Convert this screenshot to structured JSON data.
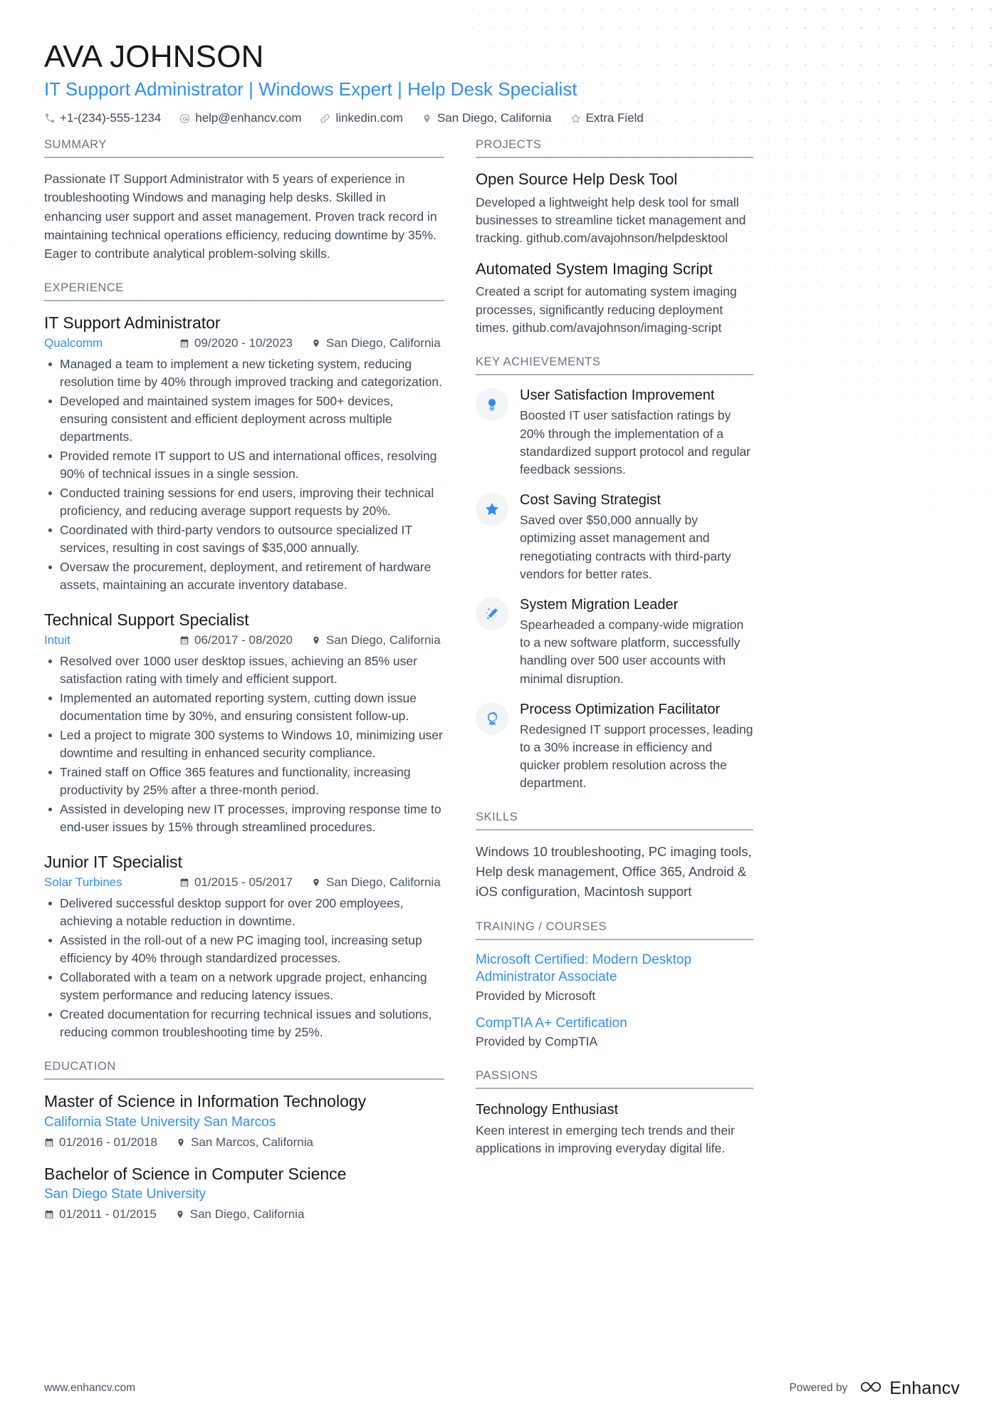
{
  "header": {
    "name": "AVA JOHNSON",
    "headline": "IT Support Administrator | Windows Expert | Help Desk Specialist",
    "contacts": [
      {
        "icon": "phone-icon",
        "text": "+1-(234)-555-1234"
      },
      {
        "icon": "email-icon",
        "text": "help@enhancv.com"
      },
      {
        "icon": "link-icon",
        "text": "linkedin.com"
      },
      {
        "icon": "location-pin-icon",
        "text": "San Diego, California"
      },
      {
        "icon": "star-outline-icon",
        "text": "Extra Field"
      }
    ]
  },
  "summary": {
    "heading": "SUMMARY",
    "text": "Passionate IT Support Administrator with 5 years of experience in troubleshooting Windows and managing help desks. Skilled in enhancing user support and asset management. Proven track record in maintaining technical operations efficiency, reducing downtime by 35%. Eager to contribute analytical problem-solving skills."
  },
  "experience": {
    "heading": "EXPERIENCE",
    "entries": [
      {
        "title": "IT Support Administrator",
        "company": "Qualcomm",
        "dates": "09/2020 - 10/2023",
        "location": "San Diego, California",
        "bullets": [
          "Managed a team to implement a new ticketing system, reducing resolution time by 40% through improved tracking and categorization.",
          "Developed and maintained system images for 500+ devices, ensuring consistent and efficient deployment across multiple departments.",
          "Provided remote IT support to US and international offices, resolving 90% of technical issues in a single session.",
          "Conducted training sessions for end users, improving their technical proficiency, and reducing average support requests by 20%.",
          "Coordinated with third-party vendors to outsource specialized IT services, resulting in cost savings of $35,000 annually.",
          "Oversaw the procurement, deployment, and retirement of hardware assets, maintaining an accurate inventory database."
        ]
      },
      {
        "title": "Technical Support Specialist",
        "company": "Intuit",
        "dates": "06/2017 - 08/2020",
        "location": "San Diego, California",
        "bullets": [
          "Resolved over 1000 user desktop issues, achieving an 85% user satisfaction rating with timely and efficient support.",
          "Implemented an automated reporting system, cutting down issue documentation time by 30%, and ensuring consistent follow-up.",
          "Led a project to migrate 300 systems to Windows 10, minimizing user downtime and resulting in enhanced security compliance.",
          "Trained staff on Office 365 features and functionality, increasing productivity by 25% after a three-month period.",
          "Assisted in developing new IT processes, improving response time to end-user issues by 15% through streamlined procedures."
        ]
      },
      {
        "title": "Junior IT Specialist",
        "company": "Solar Turbines",
        "dates": "01/2015 - 05/2017",
        "location": "San Diego, California",
        "bullets": [
          "Delivered successful desktop support for over 200 employees, achieving a notable reduction in downtime.",
          "Assisted in the roll-out of a new PC imaging tool, increasing setup efficiency by 40% through standardized processes.",
          "Collaborated with a team on a network upgrade project, enhancing system performance and reducing latency issues.",
          "Created documentation for recurring technical issues and solutions, reducing common troubleshooting time by 25%."
        ]
      }
    ]
  },
  "education": {
    "heading": "EDUCATION",
    "entries": [
      {
        "degree": "Master of Science in Information Technology",
        "school": "California State University San Marcos",
        "dates": "01/2016 - 01/2018",
        "location": "San Marcos, California"
      },
      {
        "degree": "Bachelor of Science in Computer Science",
        "school": "San Diego State University",
        "dates": "01/2011 - 01/2015",
        "location": "San Diego, California"
      }
    ]
  },
  "projects": {
    "heading": "PROJECTS",
    "entries": [
      {
        "title": "Open Source Help Desk Tool",
        "description": "Developed a lightweight help desk tool for small businesses to streamline ticket management and tracking. github.com/avajohnson/helpdesktool"
      },
      {
        "title": "Automated System Imaging Script",
        "description": "Created a script for automating system imaging processes, significantly reducing deployment times. github.com/avajohnson/imaging-script"
      }
    ]
  },
  "achievements": {
    "heading": "KEY ACHIEVEMENTS",
    "items": [
      {
        "icon": "lightbulb-icon",
        "title": "User Satisfaction Improvement",
        "description": "Boosted IT user satisfaction ratings by 20% through the implementation of a standardized support protocol and regular feedback sessions."
      },
      {
        "icon": "star-icon",
        "title": "Cost Saving Strategist",
        "description": "Saved over $50,000 annually by optimizing asset management and renegotiating contracts with third-party vendors for better rates."
      },
      {
        "icon": "magic-wand-icon",
        "title": "System Migration Leader",
        "description": "Spearheaded a company-wide migration to a new software platform, successfully handling over 500 user accounts with minimal disruption."
      },
      {
        "icon": "award-ribbon-icon",
        "title": "Process Optimization Facilitator",
        "description": "Redesigned IT support processes, leading to a 30% increase in efficiency and quicker problem resolution across the department."
      }
    ]
  },
  "skills": {
    "heading": "SKILLS",
    "text": "Windows 10 troubleshooting, PC imaging tools, Help desk management, Office 365, Android & iOS configuration, Macintosh support"
  },
  "training": {
    "heading": "TRAINING / COURSES",
    "entries": [
      {
        "name": "Microsoft Certified: Modern Desktop Administrator Associate",
        "provider": "Provided by Microsoft"
      },
      {
        "name": "CompTIA A+ Certification",
        "provider": "Provided by CompTIA"
      }
    ]
  },
  "passions": {
    "heading": "PASSIONS",
    "entries": [
      {
        "title": "Technology Enthusiast",
        "description": "Keen interest in emerging tech trends and their applications in improving everyday digital life."
      }
    ]
  },
  "footer": {
    "url": "www.enhancv.com",
    "powered_by": "Powered by",
    "brand": "Enhancv"
  },
  "colors": {
    "accent": "#2f8dfa",
    "text": "#3f4954",
    "heading": "#16181a",
    "section_label": "#6a7480"
  }
}
